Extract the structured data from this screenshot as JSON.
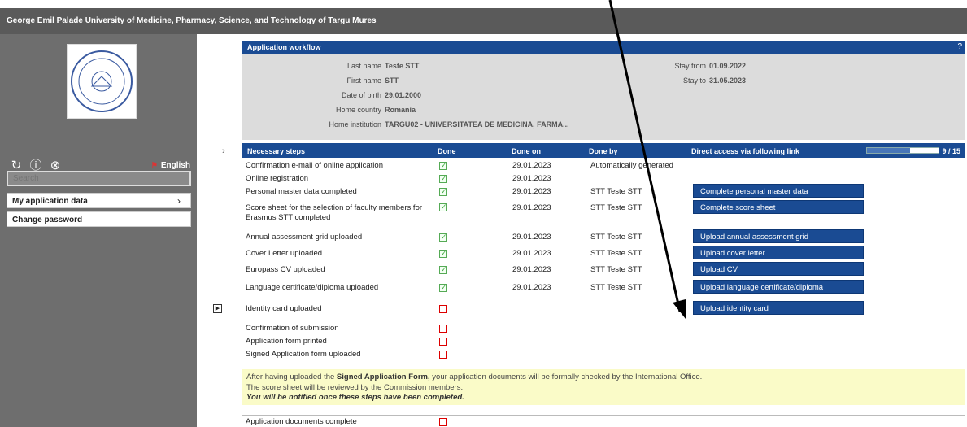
{
  "header": {
    "title": "George Emil Palade University of Medicine, Pharmacy, Science, and Technology of Targu Mures"
  },
  "sidebar": {
    "language": "English",
    "search_placeholder": "Search",
    "menu": [
      {
        "label": "My application data"
      },
      {
        "label": "Change password"
      }
    ],
    "logo_text": "UNIVERSITY"
  },
  "workflow": {
    "title": "Application workflow",
    "help": "?",
    "personal": {
      "last_name_label": "Last name",
      "last_name": "Teste STT",
      "first_name_label": "First name",
      "first_name": "STT",
      "dob_label": "Date of birth",
      "dob": "29.01.2000",
      "country_label": "Home country",
      "country": "Romania",
      "institution_label": "Home institution",
      "institution": "TARGU02 - UNIVERSITATEA DE MEDICINA, FARMA...",
      "stay_from_label": "Stay from",
      "stay_from": "01.09.2022",
      "stay_to_label": "Stay to",
      "stay_to": "31.05.2023"
    }
  },
  "steps": {
    "headers": {
      "steps": "Necessary steps",
      "done": "Done",
      "done_on": "Done on",
      "done_by": "Done by",
      "link": "Direct access via following link",
      "progress": "9 / 15"
    },
    "progress_fraction": 0.6,
    "rows": [
      {
        "label": "Confirmation e-mail of online application",
        "done": true,
        "date": "29.01.2023",
        "by": "Automatically generated",
        "button": ""
      },
      {
        "label": "Online registration",
        "done": true,
        "date": "29.01.2023",
        "by": "",
        "button": ""
      },
      {
        "label": "Personal master data completed",
        "done": true,
        "date": "29.01.2023",
        "by": "STT Teste STT",
        "button": "Complete personal master data"
      },
      {
        "label": "Score sheet for the selection of faculty members for Erasmus STT completed",
        "done": true,
        "date": "29.01.2023",
        "by": "STT Teste STT",
        "button": "Complete score sheet"
      },
      {
        "label": "Annual assessment grid uploaded",
        "done": true,
        "date": "29.01.2023",
        "by": "STT Teste STT",
        "button": "Upload annual assessment grid"
      },
      {
        "label": "Cover Letter uploaded",
        "done": true,
        "date": "29.01.2023",
        "by": "STT Teste STT",
        "button": "Upload cover letter"
      },
      {
        "label": "Europass CV uploaded",
        "done": true,
        "date": "29.01.2023",
        "by": "STT Teste STT",
        "button": "Upload CV"
      },
      {
        "label": "Language certificate/diploma uploaded",
        "done": true,
        "date": "29.01.2023",
        "by": "STT Teste STT",
        "button": "Upload language certificate/diploma"
      },
      {
        "label": "Identity card uploaded",
        "done": false,
        "date": "",
        "by": "",
        "button": "Upload identity card"
      },
      {
        "label": "Confirmation of submission",
        "done": false,
        "date": "",
        "by": "",
        "button": ""
      },
      {
        "label": "Application form printed",
        "done": false,
        "date": "",
        "by": "",
        "button": ""
      },
      {
        "label": "Signed Application form uploaded",
        "done": false,
        "date": "",
        "by": "",
        "button": ""
      }
    ],
    "final_row": {
      "label": "Application documents complete",
      "done": false
    }
  },
  "notice": {
    "line1_pre": "After having uploaded the ",
    "line1_bold": "Signed Application Form,",
    "line1_post": " your application documents will be formally checked by the International Office.",
    "line2": "The score sheet will be reviewed by the Commission members.",
    "line3": "You will be notified once these steps have been completed."
  }
}
